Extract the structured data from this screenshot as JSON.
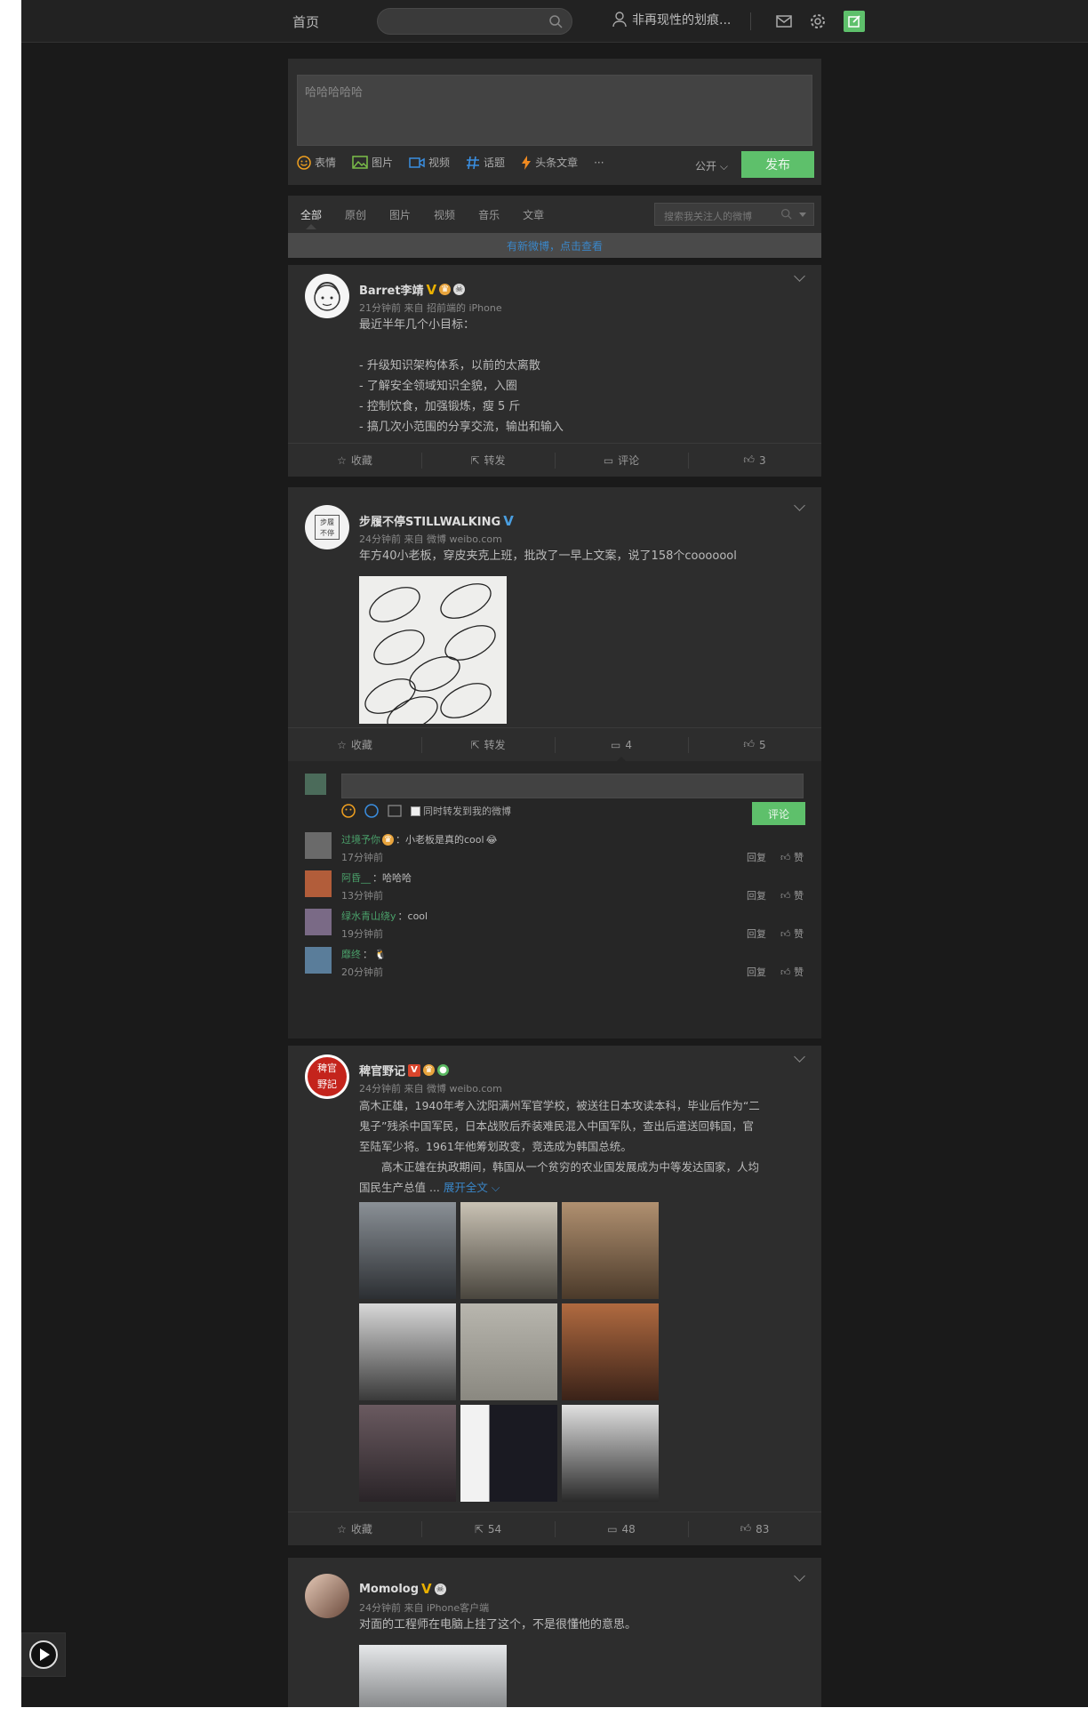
{
  "nav": {
    "home": "首页",
    "search_placeholder": "",
    "username": "非再现性的划痕..."
  },
  "composer": {
    "text": "哈哈哈哈哈",
    "tools": [
      "表情",
      "图片",
      "视频",
      "话题",
      "头条文章",
      "···"
    ],
    "visibility": "公开",
    "publish": "发布"
  },
  "filters": {
    "tabs": [
      "全部",
      "原创",
      "图片",
      "视频",
      "音乐",
      "文章"
    ],
    "search_placeholder": "搜索我关注人的微博",
    "new_notice": "有新微博，点击查看"
  },
  "posts": [
    {
      "name": "Barret李靖",
      "meta": "21分钟前 来自 招前端的 iPhone",
      "lines": [
        "最近半年几个小目标：",
        "",
        "- 升级知识架构体系，以前的太离散",
        "- 了解安全领域知识全貌，入圈",
        "- 控制饮食，加强锻炼，瘦 5 斤",
        "- 搞几次小范围的分享交流，输出和输入"
      ],
      "actions": [
        "收藏",
        "转发",
        "评论",
        "3"
      ]
    },
    {
      "name": "步履不停STILLWALKING",
      "meta": "24分钟前 来自 微博 weibo.com",
      "lines": [
        "年方40小老板，穿皮夹克上班，批改了一早上文案，说了158个cooooool"
      ],
      "actions": [
        "收藏",
        "转发",
        "4",
        "5"
      ],
      "comment_box": {
        "forward_label": "同时转发到我的微博",
        "submit": "评论"
      },
      "comments": [
        {
          "name": "过境予你",
          "text": "：小老板是真的cool",
          "time": "17分钟前"
        },
        {
          "name": "阿昏__",
          "text": "：哈哈哈",
          "time": "13分钟前"
        },
        {
          "name": "绿水青山绕y",
          "text": "：cool",
          "time": "19分钟前"
        },
        {
          "name": "靡终",
          "text": "：",
          "time": "20分钟前"
        }
      ],
      "comment_ops": [
        "回复",
        "赞"
      ]
    },
    {
      "name": "稗官野记",
      "meta": "24分钟前 来自 微博 weibo.com",
      "lines": [
        "高木正雄，1940年考入沈阳满州军官学校，被送往日本攻读本科，毕业后作为“二",
        "鬼子”残杀中国军民，日本战败后乔装难民混入中国军队，查出后遣送回韩国，官",
        "至陆军少将。1961年他筹划政变，竞选成为韩国总统。",
        "　　高木正雄在执政期间，韩国从一个贫穷的农业国发展成为中等发达国家，人均",
        "国民生产总值 ..."
      ],
      "expand": "展开全文",
      "actions": [
        "收藏",
        "54",
        "48",
        "83"
      ]
    },
    {
      "name": "Momolog",
      "meta": "24分钟前 来自 iPhone客户端",
      "lines": [
        "对面的工程师在电脑上挂了这个，不是很懂他的意思。"
      ]
    }
  ],
  "colors": {
    "accent_green": "#5ec06b",
    "link_blue": "#3a86c8",
    "background": "#1a1a1a",
    "card": "#2d2d2d"
  }
}
